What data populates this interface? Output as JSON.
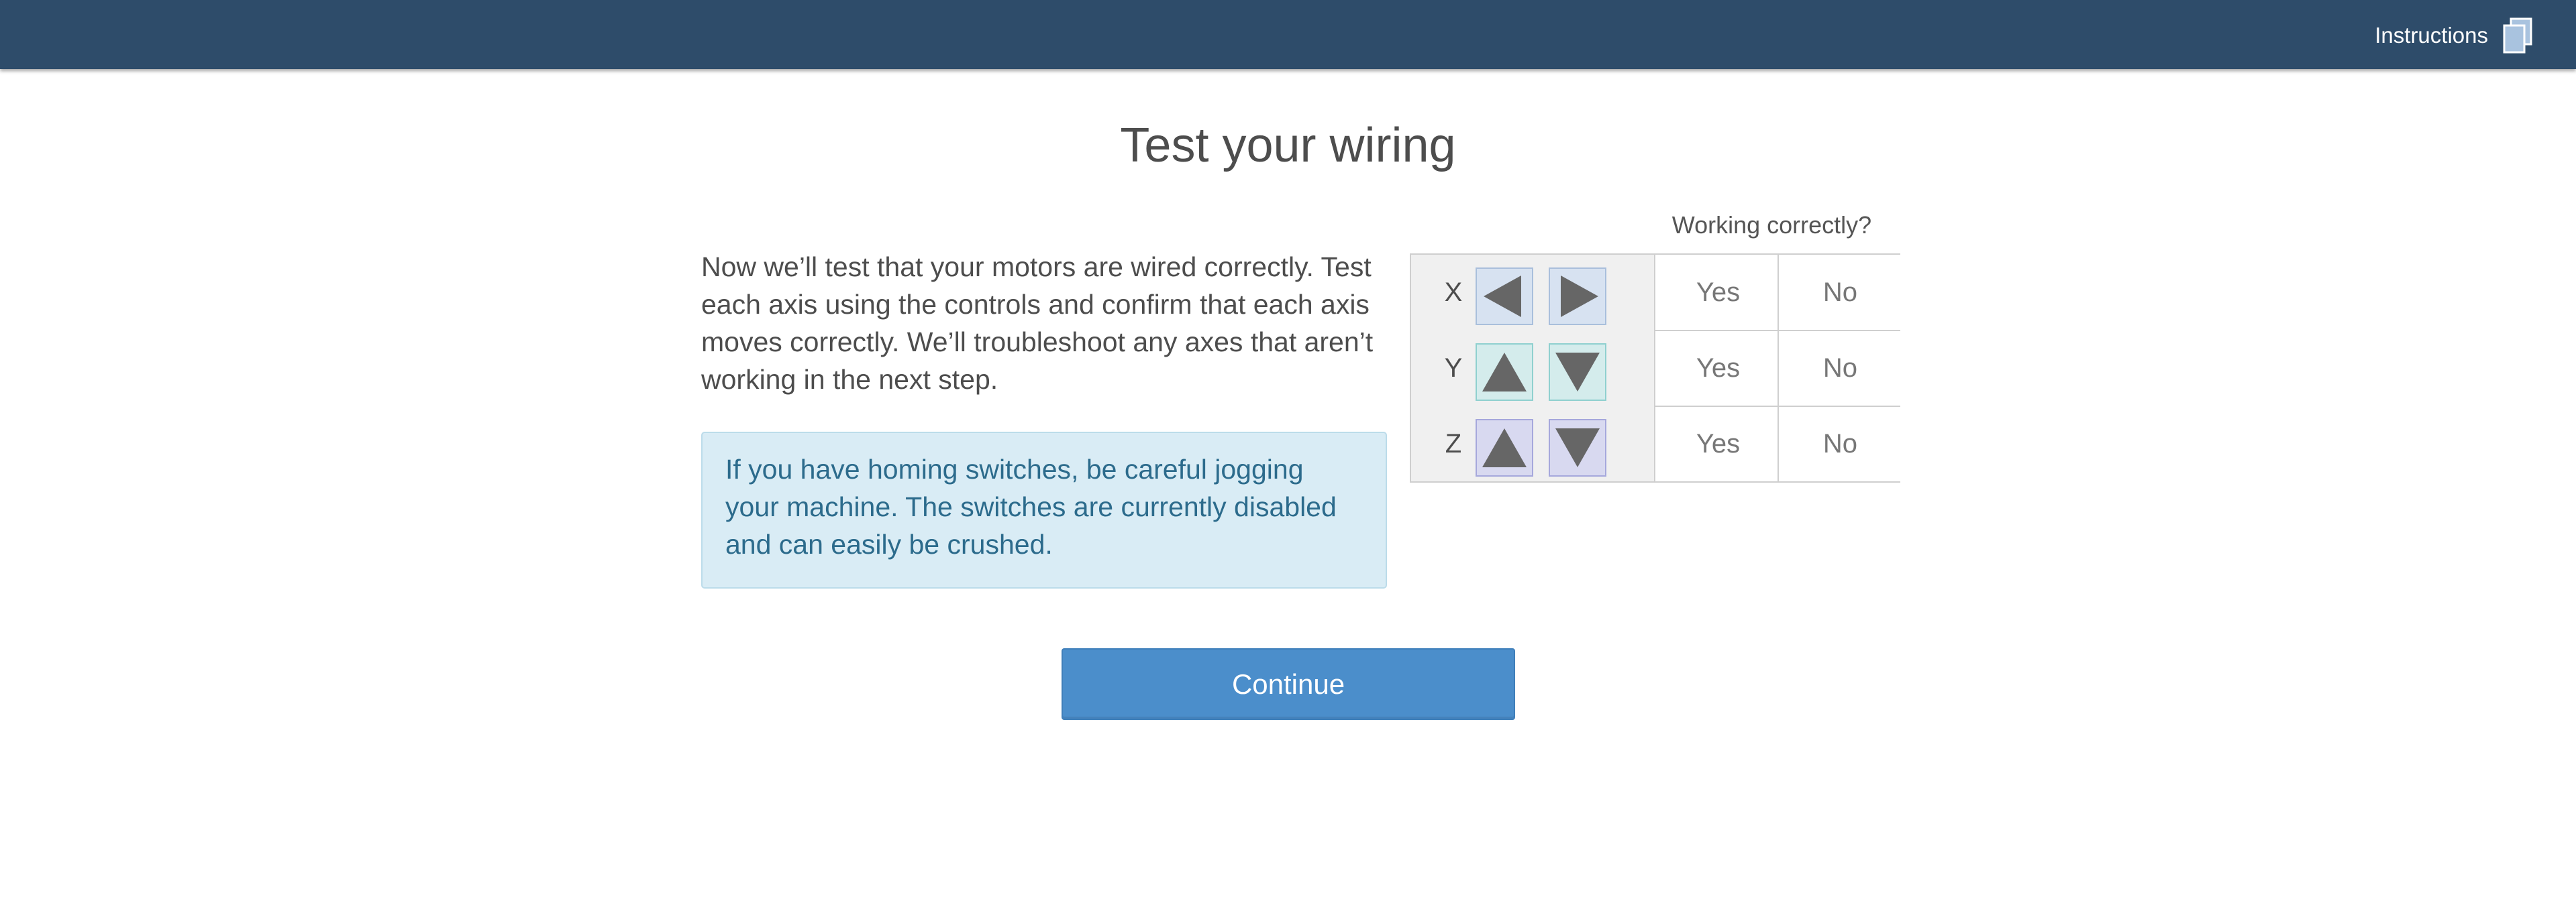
{
  "header": {
    "instructions_label": "Instructions",
    "icon": "documents-icon",
    "background_color": "#2e4c6a"
  },
  "main": {
    "title": "Test your wiring",
    "intro": "Now we’ll test that your motors are wired correctly. Test each axis using the controls and confirm that each axis moves correctly. We’ll troubleshoot any axes that aren’t working in the next step.",
    "notice": "If you have homing switches, be careful jogging your machine. The switches are currently disabled and can easily be crushed."
  },
  "axis_table": {
    "column_header": "Working correctly?",
    "rows": [
      {
        "axis": "X",
        "buttons": [
          "arrow-left-icon",
          "arrow-right-icon"
        ],
        "yes": "Yes",
        "no": "No"
      },
      {
        "axis": "Y",
        "buttons": [
          "arrow-up-icon",
          "arrow-down-icon"
        ],
        "yes": "Yes",
        "no": "No"
      },
      {
        "axis": "Z",
        "buttons": [
          "arrow-up-icon",
          "arrow-down-icon"
        ],
        "yes": "Yes",
        "no": "No"
      }
    ]
  },
  "footer": {
    "continue_label": "Continue",
    "button_color": "#4b8ecb"
  }
}
